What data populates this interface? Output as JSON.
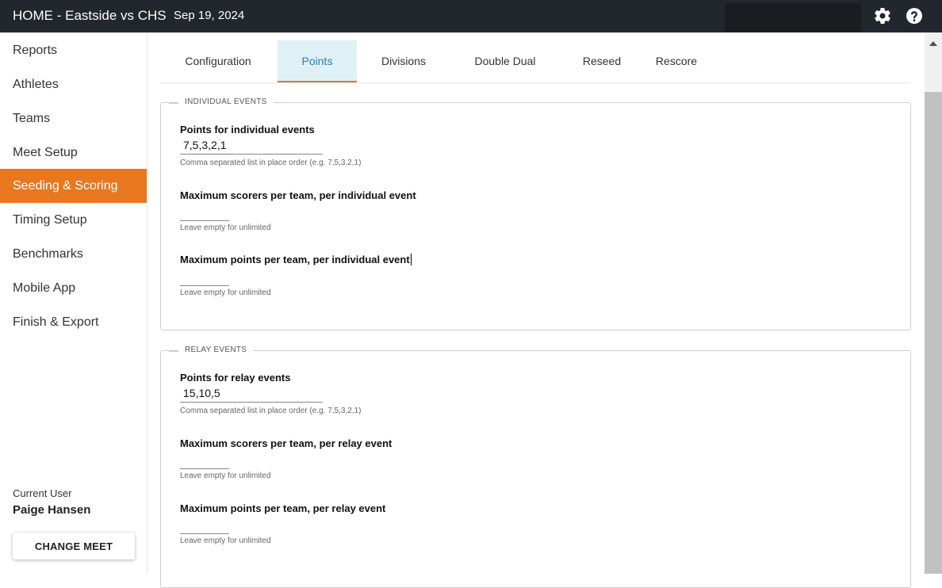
{
  "header": {
    "title": "HOME - Eastside vs CHS",
    "date": "Sep 19, 2024",
    "icons": [
      "gear-icon",
      "help-icon"
    ]
  },
  "sidebar": {
    "items": [
      {
        "label": "Reports"
      },
      {
        "label": "Athletes"
      },
      {
        "label": "Teams"
      },
      {
        "label": "Meet Setup"
      },
      {
        "label": "Seeding & Scoring",
        "active": true
      },
      {
        "label": "Timing Setup"
      },
      {
        "label": "Benchmarks"
      },
      {
        "label": "Mobile App"
      },
      {
        "label": "Finish & Export"
      }
    ],
    "current_user_label": "Current User",
    "current_user_name": "Paige Hansen",
    "change_meet_label": "CHANGE MEET"
  },
  "tabs": [
    {
      "label": "Configuration"
    },
    {
      "label": "Points",
      "active": true
    },
    {
      "label": "Divisions"
    },
    {
      "label": "Double Dual"
    },
    {
      "label": "Reseed"
    },
    {
      "label": "Rescore"
    }
  ],
  "individual": {
    "legend": "INDIVIDUAL EVENTS",
    "points_label": "Points for individual events",
    "points_value": "7,5,3,2,1",
    "points_hint": "Comma separated list in place order (e.g. 7,5,3,2,1)",
    "max_scorers_label": "Maximum scorers per team, per individual event",
    "max_scorers_value": "",
    "max_scorers_hint": "Leave empty for unlimited",
    "max_points_label": "Maximum points per team, per individual event",
    "max_points_value": "",
    "max_points_hint": "Leave empty for unlimited"
  },
  "relay": {
    "legend": "RELAY EVENTS",
    "points_label": "Points for relay events",
    "points_value": "15,10,5",
    "points_hint": "Comma separated list in place order (e.g. 7,5,3,2,1)",
    "max_scorers_label": "Maximum scorers per team, per relay event",
    "max_scorers_value": "",
    "max_scorers_hint": "Leave empty for unlimited",
    "max_points_label": "Maximum points per team, per relay event",
    "max_points_value": "",
    "max_points_hint": "Leave empty for unlimited"
  },
  "colors": {
    "topbar": "#22272e",
    "accent": "#e8781f",
    "tab_active_bg": "#dff0f7",
    "tab_active_text": "#2e7fae"
  }
}
